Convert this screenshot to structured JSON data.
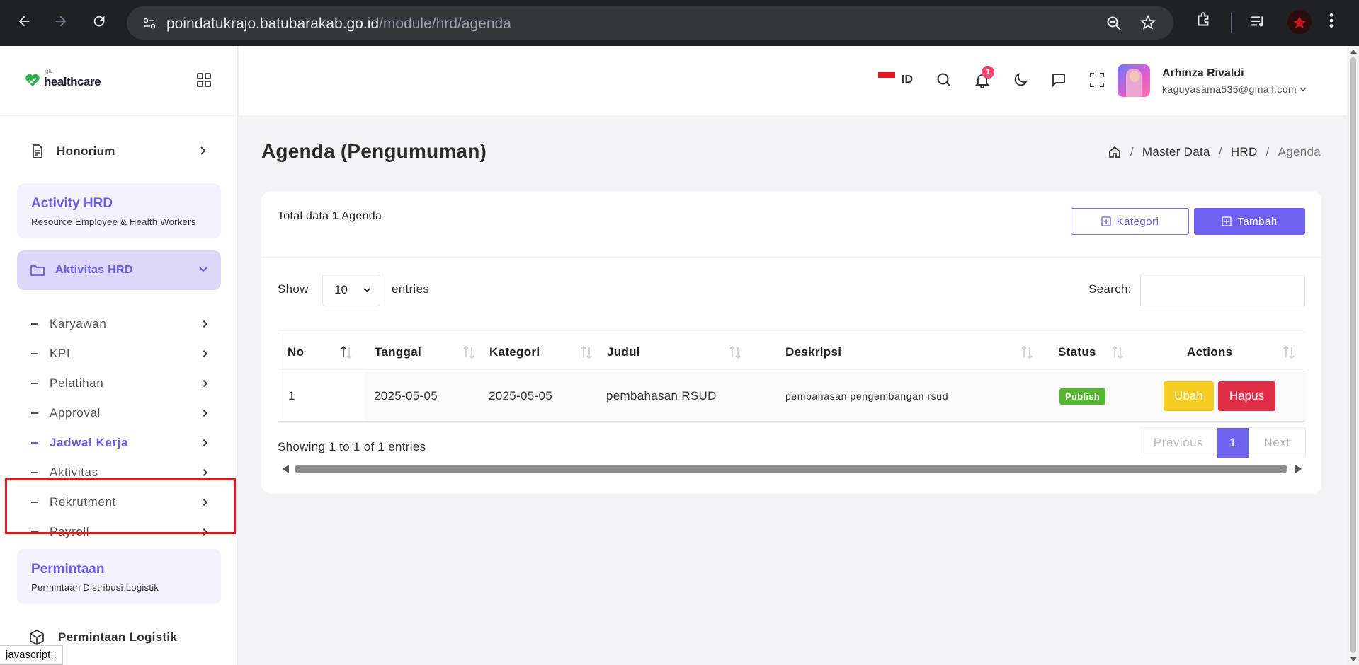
{
  "browser": {
    "url_host": "poindatukrajo.batubarakab.go.id",
    "url_path": "/module/hrd/agenda",
    "status_url": "javascript:;"
  },
  "sidebar": {
    "logo_small": "glu",
    "logo_name": "healthcare",
    "honorium": "Honorium",
    "activity_title": "Activity HRD",
    "activity_sub": "Resource Employee & Health Workers",
    "group_label": "Aktivitas HRD",
    "items": [
      {
        "label": "Karyawan"
      },
      {
        "label": "KPI"
      },
      {
        "label": "Pelatihan"
      },
      {
        "label": "Approval"
      },
      {
        "label": "Jadwal Kerja"
      },
      {
        "label": "Aktivitas"
      },
      {
        "label": "Rekrutment"
      },
      {
        "label": "Payroll"
      }
    ],
    "permintaan_title": "Permintaan",
    "permintaan_sub": "Permintaan Distribusi Logistik",
    "permintaan_logistik": "Permintaan Logistik"
  },
  "header": {
    "lang": "ID",
    "notif_count": "1",
    "user_name": "Arhinza Rivaldi",
    "user_email": "kaguyasama535@gmail.com"
  },
  "page": {
    "title": "Agenda (Pengumuman)",
    "breadcrumb": [
      "Master Data",
      "HRD",
      "Agenda"
    ]
  },
  "card": {
    "total_prefix": "Total data ",
    "total_count": "1",
    "total_suffix": " Agenda",
    "btn_kategori": "Kategori",
    "btn_tambah": "Tambah",
    "show_label": "Show",
    "entries_value": "10",
    "entries_label": "entries",
    "search_label": "Search:",
    "columns": [
      "No",
      "Tanggal",
      "Kategori",
      "Judul",
      "Deskripsi",
      "Status",
      "Actions"
    ],
    "rows": [
      {
        "no": "1",
        "tanggal": "2025-05-05",
        "kategori": "2025-05-05",
        "judul": "pembahasan RSUD",
        "deskripsi": "pembahasan pengembangan rsud",
        "status": "Publish",
        "ubah": "Ubah",
        "hapus": "Hapus"
      }
    ],
    "showing": "Showing 1 to 1 of 1 entries",
    "pager": {
      "prev": "Previous",
      "current": "1",
      "next": "Next"
    }
  },
  "colors": {
    "accent": "#6f61ef",
    "publish": "#52b72f",
    "ubah": "#f6cb22",
    "hapus": "#e12f47",
    "highlight_box": "#e8151c"
  }
}
